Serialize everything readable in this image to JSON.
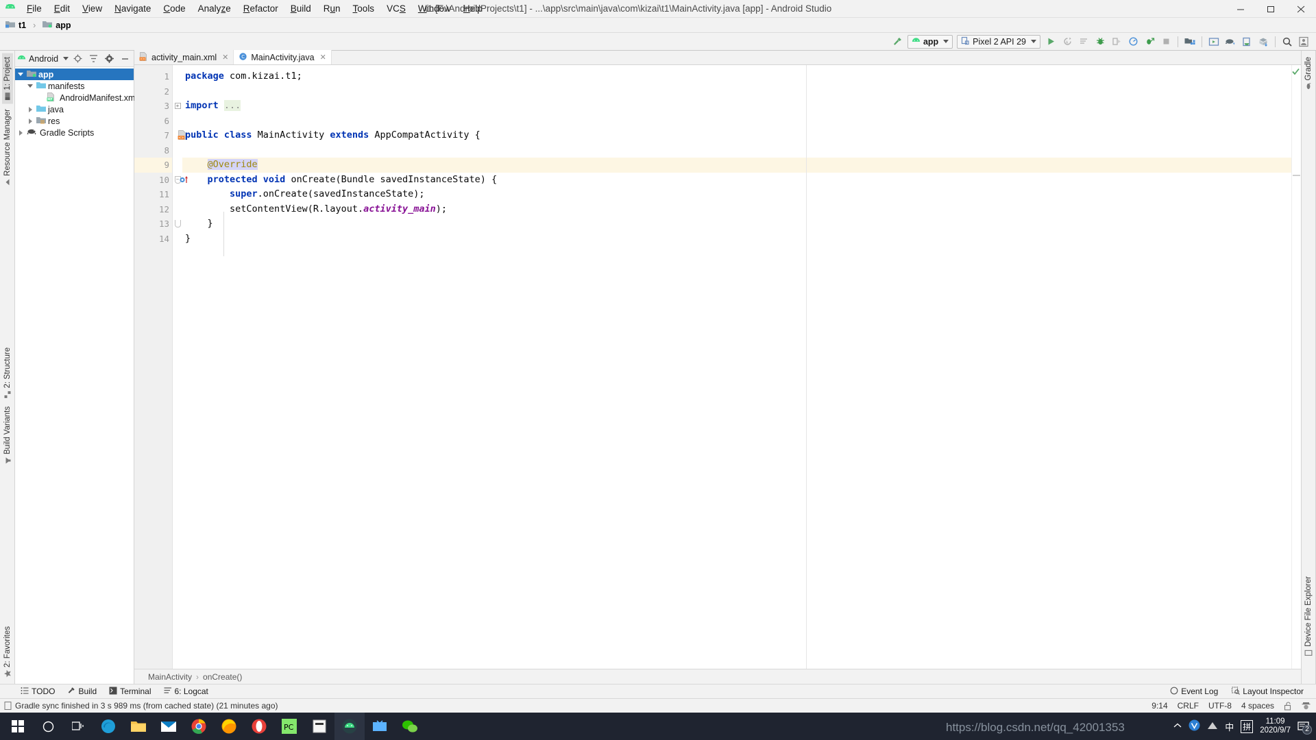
{
  "window": {
    "title": "t1 [F:\\AndroidProjects\\t1] - ...\\app\\src\\main\\java\\com\\kizai\\t1\\MainActivity.java [app] - Android Studio",
    "minimize": "—",
    "maximize": "❐",
    "close": "✕",
    "logo_icon": "android-logo-icon"
  },
  "menu": {
    "items": [
      {
        "label": "File",
        "mnemonic": "F"
      },
      {
        "label": "Edit",
        "mnemonic": "E"
      },
      {
        "label": "View",
        "mnemonic": "V"
      },
      {
        "label": "Navigate",
        "mnemonic": "N"
      },
      {
        "label": "Code",
        "mnemonic": "C"
      },
      {
        "label": "Analyze",
        "mnemonic": "z"
      },
      {
        "label": "Refactor",
        "mnemonic": "R"
      },
      {
        "label": "Build",
        "mnemonic": "B"
      },
      {
        "label": "Run",
        "mnemonic": "u"
      },
      {
        "label": "Tools",
        "mnemonic": "T"
      },
      {
        "label": "VCS",
        "mnemonic": "S"
      },
      {
        "label": "Window",
        "mnemonic": "W"
      },
      {
        "label": "Help",
        "mnemonic": "H"
      }
    ]
  },
  "breadcrumb_top": {
    "project": "t1",
    "module": "app",
    "separator": "›"
  },
  "toolbar": {
    "build_icon": "hammer-build-icon",
    "run_config": {
      "label": "app",
      "icon": "android-app-icon"
    },
    "device": {
      "label": "Pixel 2 API 29",
      "icon": "device-phone-icon"
    },
    "run_icon": "run-play-icon",
    "apply_changes_icon": "apply-changes-icon",
    "apply_code_changes_icon": "apply-code-changes-icon",
    "debug_icon": "debug-bug-icon",
    "debug_attach_icon": "attach-debugger-icon",
    "profiler_icon": "profiler-icon",
    "run_with_coverage_icon": "run-coverage-icon",
    "stop_icon": "stop-square-icon",
    "sdk_manager_icon": "sdk-manager-icon",
    "avd_manager_icon": "avd-manager-icon",
    "layout_inspector_icon": "layout-inspector-icon",
    "device_file_explorer_icon": "device-file-explorer-icon",
    "sync_project_icon": "gradle-sync-icon",
    "search_icon": "search-everywhere-icon",
    "account_icon": "user-account-icon"
  },
  "left_rail": {
    "top": [
      {
        "label": "1: Project",
        "icon": "project-tool-icon",
        "active": true
      },
      {
        "label": "Resource Manager",
        "icon": "resource-manager-icon",
        "active": false
      }
    ],
    "middle": [
      {
        "label": "2: Structure",
        "icon": "structure-tool-icon",
        "active": false
      },
      {
        "label": "Build Variants",
        "icon": "build-variants-icon",
        "active": false
      }
    ],
    "bottom": [
      {
        "label": "2: Favorites",
        "icon": "favorites-star-icon",
        "active": false
      }
    ]
  },
  "right_rail": {
    "items": [
      {
        "label": "Gradle",
        "icon": "gradle-elephant-icon"
      },
      {
        "label": "Device File Explorer",
        "icon": "device-file-explorer-icon"
      }
    ]
  },
  "project_panel": {
    "view_selector": "Android",
    "view_icon": "android-head-icon",
    "locate_icon": "locate-target-icon",
    "collapse_icon": "collapse-all-icon",
    "settings_icon": "gear-icon",
    "hide_icon": "hide-minus-icon",
    "tree": [
      {
        "label": "app",
        "icon": "module-folder-icon",
        "depth": 0,
        "twisty": "down",
        "selected": true,
        "bold": true
      },
      {
        "label": "manifests",
        "icon": "folder-icon",
        "depth": 1,
        "twisty": "down",
        "selected": false,
        "bold": false
      },
      {
        "label": "AndroidManifest.xml",
        "icon": "manifest-file-icon",
        "depth": 2,
        "twisty": "none",
        "selected": false,
        "bold": false
      },
      {
        "label": "java",
        "icon": "folder-icon",
        "depth": 1,
        "twisty": "right",
        "selected": false,
        "bold": false
      },
      {
        "label": "res",
        "icon": "res-folder-icon",
        "depth": 1,
        "twisty": "right",
        "selected": false,
        "bold": false
      },
      {
        "label": "Gradle Scripts",
        "icon": "gradle-elephant-icon",
        "depth": 0,
        "twisty": "right",
        "selected": false,
        "bold": false
      }
    ]
  },
  "editor_tabs": [
    {
      "label": "activity_main.xml",
      "icon": "xml-layout-file-icon",
      "active": false,
      "close": "✕"
    },
    {
      "label": "MainActivity.java",
      "icon": "java-class-icon",
      "active": true,
      "close": "✕"
    }
  ],
  "editor": {
    "line_numbers": [
      "1",
      "2",
      "3",
      "6",
      "7",
      "8",
      "9",
      "10",
      "11",
      "12",
      "13",
      "14"
    ],
    "highlighted_line": "9",
    "lines": [
      {
        "num": "1",
        "text": "package com.kizai.t1;"
      },
      {
        "num": "2",
        "text": ""
      },
      {
        "num": "3",
        "text": "import ..."
      },
      {
        "num": "6",
        "text": ""
      },
      {
        "num": "7",
        "text": "public class MainActivity extends AppCompatActivity {"
      },
      {
        "num": "8",
        "text": ""
      },
      {
        "num": "9",
        "text": "    @Override"
      },
      {
        "num": "10",
        "text": "    protected void onCreate(Bundle savedInstanceState) {"
      },
      {
        "num": "11",
        "text": "        super.onCreate(savedInstanceState);"
      },
      {
        "num": "12",
        "text": "        setContentView(R.layout.activity_main);"
      },
      {
        "num": "13",
        "text": "    }"
      },
      {
        "num": "14",
        "text": "}"
      }
    ],
    "gutter_icons": {
      "line7": "xml-layout-relation-icon",
      "line10": "override-method-marker-icon"
    },
    "inspection_status": "ok-checkmark-icon"
  },
  "breadcrumb_bottom": {
    "class": "MainActivity",
    "method": "onCreate()",
    "separator": "›"
  },
  "tool_windows": {
    "left": [
      {
        "label": "TODO",
        "icon": "todo-list-icon",
        "mnemonic": ""
      },
      {
        "label": "Build",
        "icon": "hammer-build-icon",
        "mnemonic": ""
      },
      {
        "label": "Terminal",
        "icon": "terminal-icon",
        "mnemonic": ""
      },
      {
        "label": "6: Logcat",
        "icon": "logcat-icon",
        "mnemonic": "6"
      }
    ],
    "right": [
      {
        "label": "Event Log",
        "icon": "event-log-icon"
      },
      {
        "label": "Layout Inspector",
        "icon": "layout-inspector-icon"
      }
    ]
  },
  "status_bar": {
    "message": "Gradle sync finished in 3 s 989 ms (from cached state) (21 minutes ago)",
    "message_icon": "info-document-icon",
    "caret_position": "9:14",
    "line_separator": "CRLF",
    "encoding": "UTF-8",
    "indent": "4 spaces",
    "lock_icon": "unlocked-padlock-icon",
    "inspector_icon": "hector-inspection-icon"
  },
  "taskbar": {
    "items": [
      {
        "name": "start-button-icon"
      },
      {
        "name": "cortana-search-icon"
      },
      {
        "name": "task-view-icon"
      },
      {
        "name": "microsoft-edge-icon"
      },
      {
        "name": "file-explorer-icon"
      },
      {
        "name": "mail-icon"
      },
      {
        "name": "google-chrome-icon"
      },
      {
        "name": "firefox-icon"
      },
      {
        "name": "opera-icon"
      },
      {
        "name": "pycharm-icon"
      },
      {
        "name": "office-icon"
      },
      {
        "name": "android-studio-icon",
        "active": true
      },
      {
        "name": "bilibili-icon"
      },
      {
        "name": "wechat-icon"
      }
    ],
    "tray": {
      "chevron_icon": "show-hidden-icons-icon",
      "v2ray_icon": "v2ray-tray-icon",
      "network_icon": "network-tray-icon",
      "ime_cn_icon": "ime-chinese-icon",
      "ime_pinyin_icon": "ime-pinyin-icon",
      "notification_icon": "notification-center-icon",
      "notification_count": "2"
    },
    "clock": {
      "time": "11:09",
      "date": "2020/9/7"
    },
    "watermark": "https://blog.csdn.net/qq_42001353"
  }
}
